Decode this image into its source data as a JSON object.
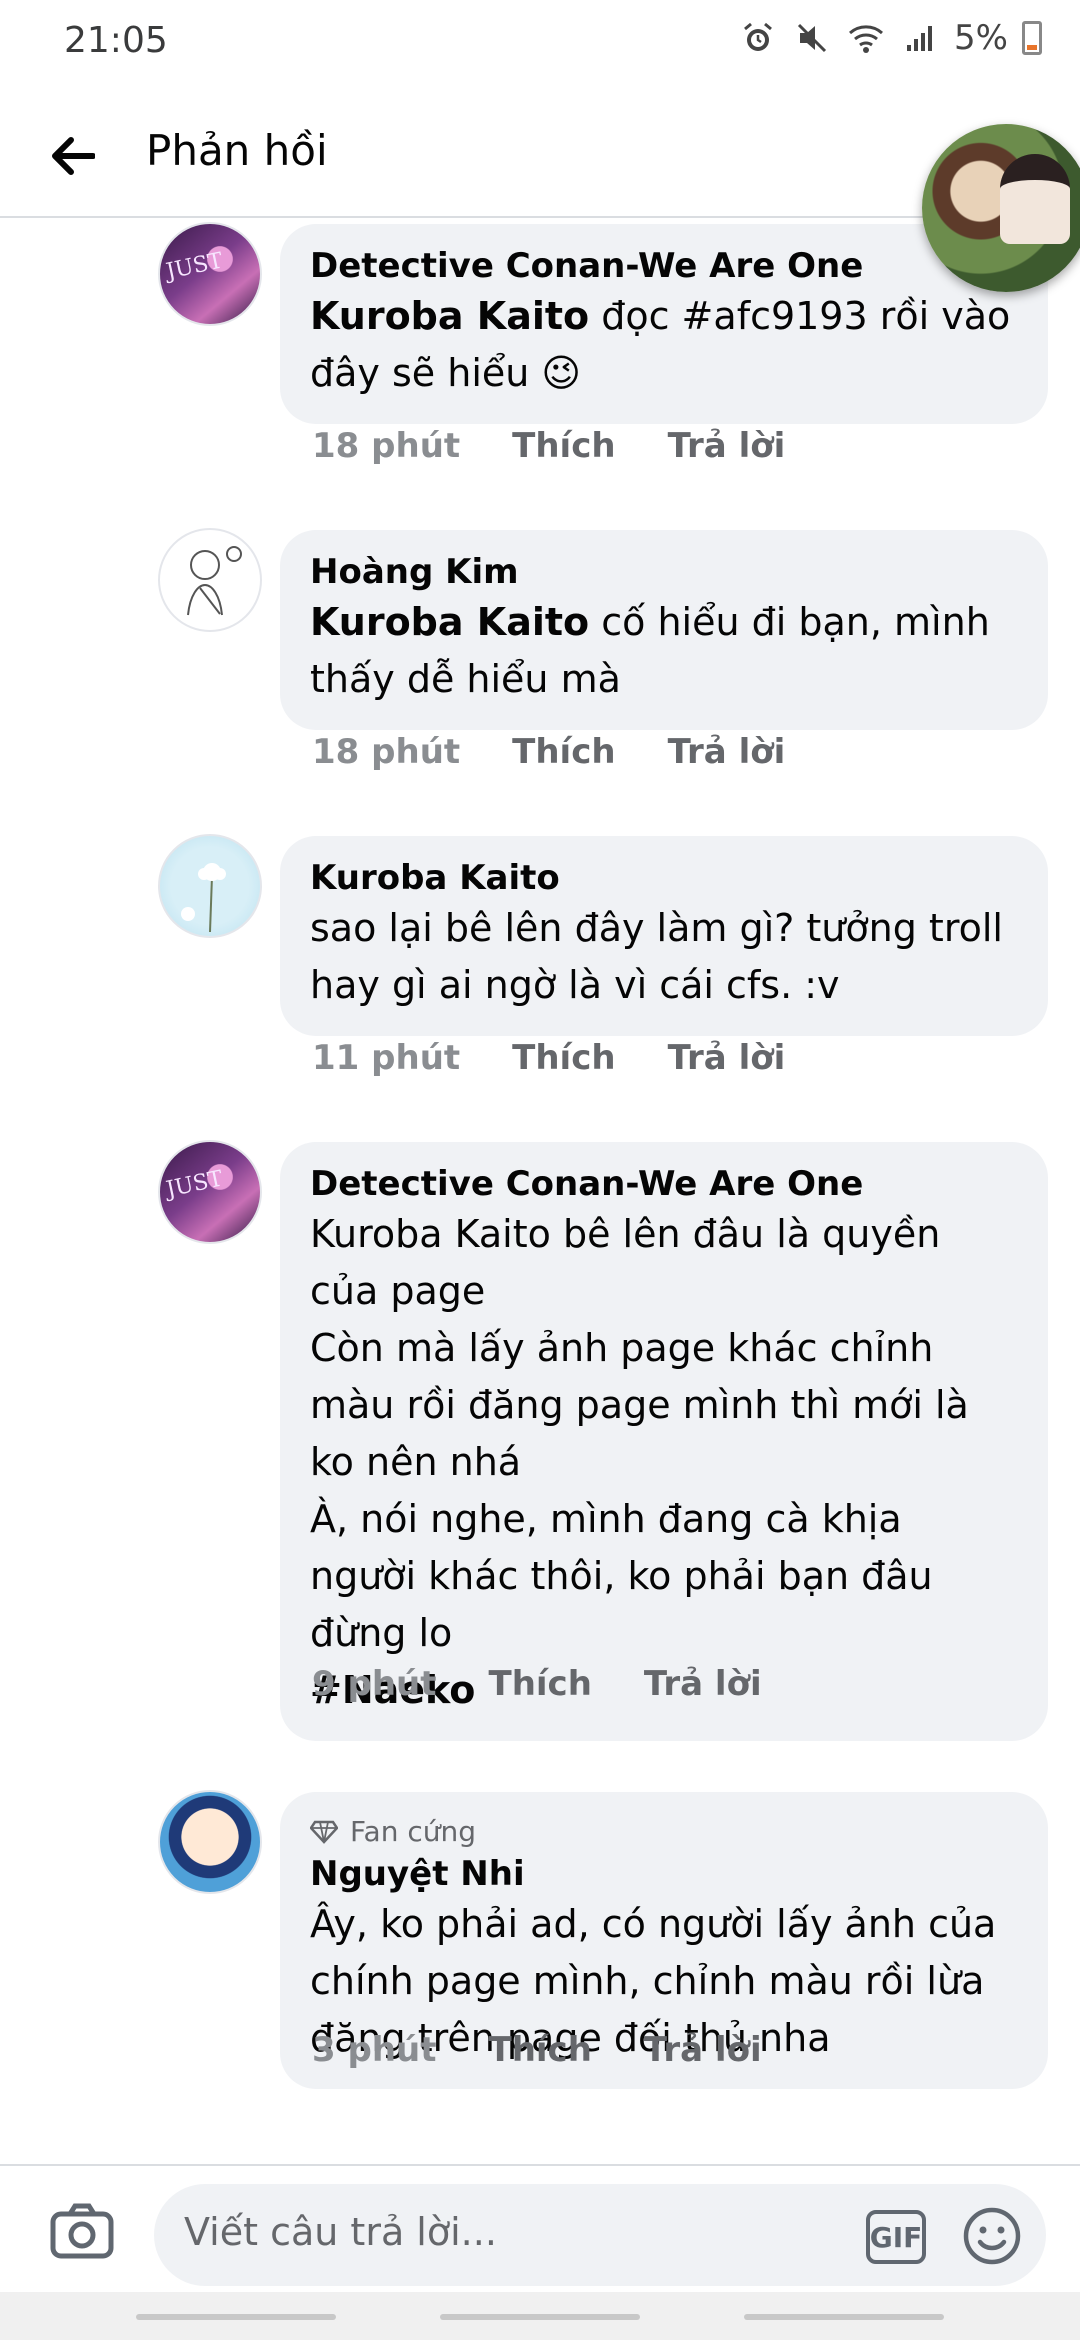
{
  "status_bar": {
    "time": "21:05",
    "battery": "5%"
  },
  "header": {
    "title": "Phản hồi"
  },
  "comments": [
    {
      "author": "Detective Conan-We Are One",
      "mention": "Kuroba Kaito",
      "text_after_mention": " đọc #afc9193 rồi vào đây sẽ hiểu 😉",
      "time": "18 phút",
      "like": "Thích",
      "reply": "Trả lời"
    },
    {
      "author": "Hoàng Kim",
      "mention": "Kuroba Kaito",
      "text_after_mention": " cố hiểu đi bạn, mình thấy dễ hiểu mà",
      "time": "18 phút",
      "like": "Thích",
      "reply": "Trả lời"
    },
    {
      "author": "Kuroba Kaito",
      "text": "sao lại bê lên đây làm gì? tưởng troll hay gì ai ngờ là vì cái cfs. :v",
      "time": "11 phút",
      "like": "Thích",
      "reply": "Trả lời"
    },
    {
      "author": "Detective Conan-We Are One",
      "text": "Kuroba Kaito bê lên đâu là quyền của page\nCòn mà lấy ảnh page khác chỉnh màu rồi đăng page mình thì mới là ko nên nhá\nÀ, nói nghe, mình đang cà khịa người khác thôi, ko phải bạn đâu đừng lo",
      "hashtag": "#Naeko",
      "time": "9 phút",
      "like": "Thích",
      "reply": "Trả lời"
    },
    {
      "badge": "Fan cứng",
      "author": "Nguyệt Nhi",
      "text": "Ây, ko phải ad, có người lấy ảnh của chính page mình, chỉnh màu rồi lừa đăng trên page đối thủ nha",
      "time": "3 phút",
      "like": "Thích",
      "reply": "Trả lời"
    }
  ],
  "composer": {
    "placeholder": "Viết câu trả lời...",
    "gif_label": "GIF"
  }
}
